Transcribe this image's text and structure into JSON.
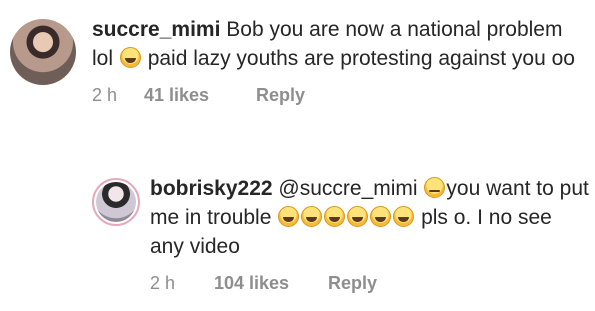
{
  "comments": [
    {
      "username": "succre_mimi",
      "text_before": " Bob you are now a national problem lol ",
      "emoji": "grinning-sweat-face",
      "text_after": " paid lazy youths are protesting against you oo",
      "time": "2 h",
      "likes": "41 likes",
      "reply_label": "Reply"
    },
    {
      "username": "bobrisky222",
      "mention": " @succre_mimi ",
      "emoji_1": "eye-roll-face",
      "text_mid": "you want to put me in trouble ",
      "emoji_row": [
        "grinning-sweat-face",
        "grinning-sweat-face",
        "grinning-sweat-face",
        "grinning-sweat-face",
        "grinning-sweat-face",
        "grinning-sweat-face"
      ],
      "text_after": " pls o. I no see any video",
      "time": "2 h",
      "likes": "104 likes",
      "reply_label": "Reply"
    }
  ]
}
